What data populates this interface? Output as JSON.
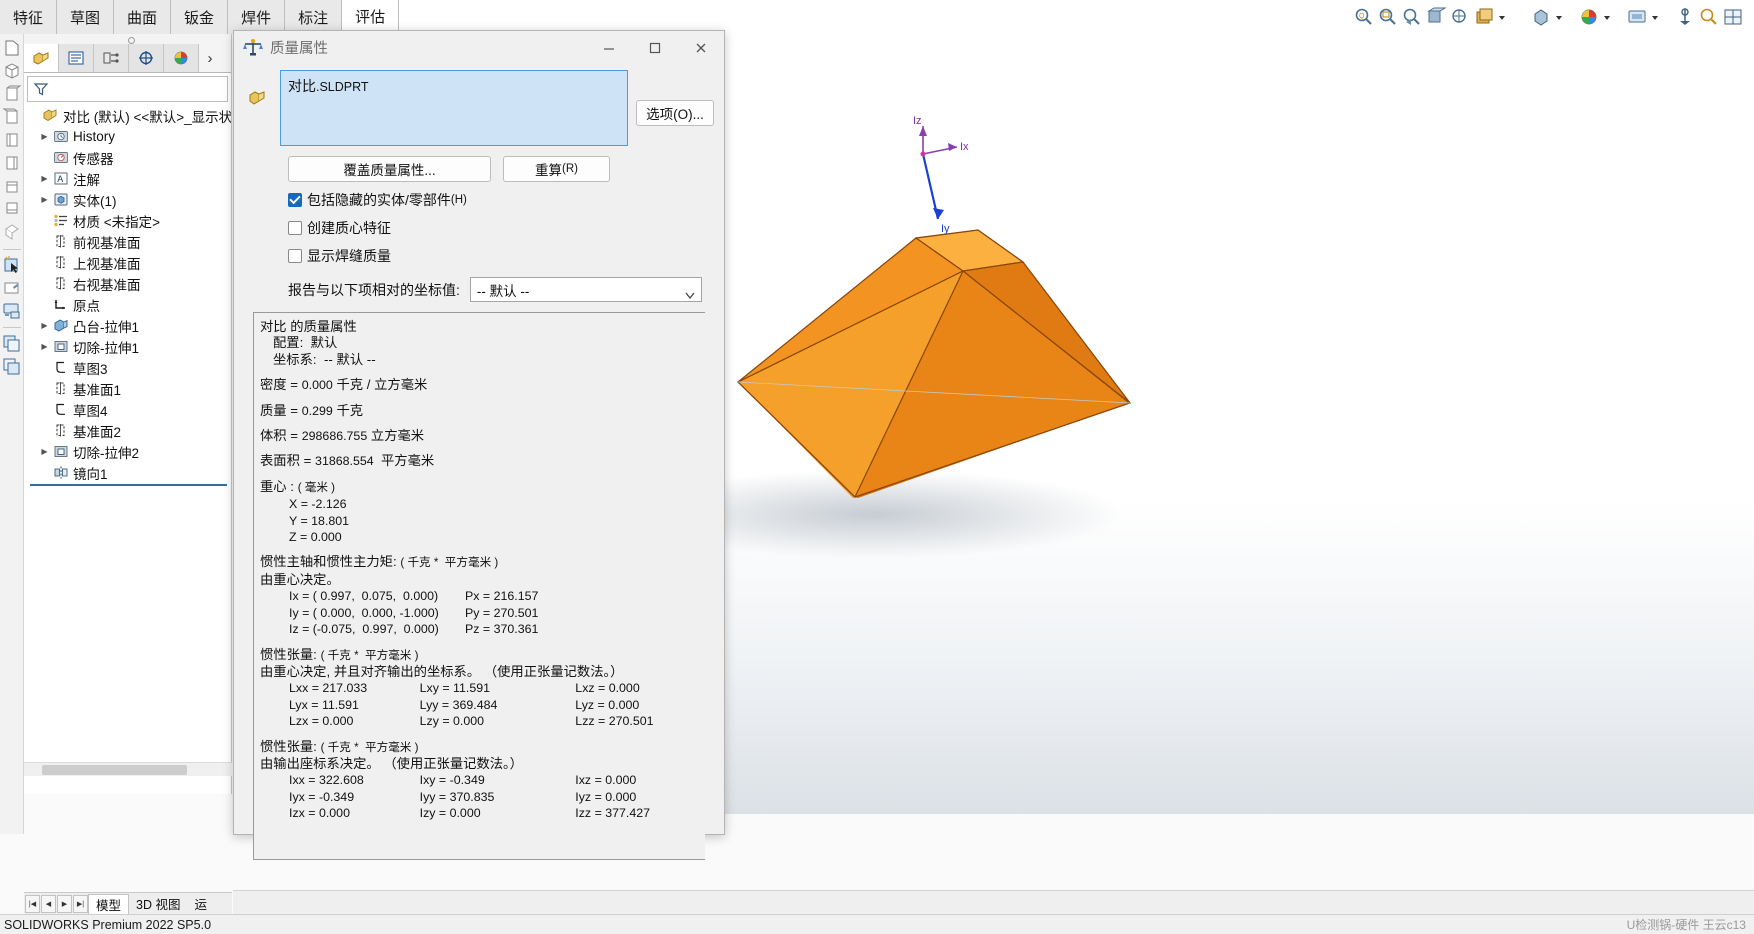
{
  "command_tabs": [
    {
      "label": "特征",
      "active": false
    },
    {
      "label": "草图",
      "active": false
    },
    {
      "label": "曲面",
      "active": false
    },
    {
      "label": "钣金",
      "active": false
    },
    {
      "label": "焊件",
      "active": false
    },
    {
      "label": "标注",
      "active": false
    },
    {
      "label": "评估",
      "active": true
    }
  ],
  "feature_manager": {
    "tabs": [
      {
        "name": "feature-tree-tab",
        "active": true
      },
      {
        "name": "property-manager-tab",
        "active": false
      },
      {
        "name": "configuration-manager-tab",
        "active": false
      },
      {
        "name": "dimxpert-manager-tab",
        "active": false
      },
      {
        "name": "display-manager-tab",
        "active": false
      }
    ],
    "more_tabs_glyph": "›",
    "filter_placeholder": "",
    "root": {
      "label": "对比 (默认) <<默认>_显示状态",
      "icon": "part-icon"
    },
    "items": [
      {
        "label": "History",
        "icon": "history-icon",
        "expandable": true,
        "indent": 1
      },
      {
        "label": "传感器",
        "icon": "sensor-icon",
        "expandable": false,
        "indent": 1
      },
      {
        "label": "注解",
        "icon": "annotation-icon",
        "expandable": true,
        "indent": 1
      },
      {
        "label": "实体(1)",
        "icon": "solid-bodies-icon",
        "expandable": true,
        "indent": 1
      },
      {
        "label": "材质 <未指定>",
        "icon": "material-icon",
        "expandable": false,
        "indent": 1
      },
      {
        "label": "前视基准面",
        "icon": "plane-icon",
        "expandable": false,
        "indent": 1
      },
      {
        "label": "上视基准面",
        "icon": "plane-icon",
        "expandable": false,
        "indent": 1
      },
      {
        "label": "右视基准面",
        "icon": "plane-icon",
        "expandable": false,
        "indent": 1
      },
      {
        "label": "原点",
        "icon": "origin-icon",
        "expandable": false,
        "indent": 1
      },
      {
        "label": "凸台-拉伸1",
        "icon": "boss-extrude-icon",
        "expandable": true,
        "indent": 1
      },
      {
        "label": "切除-拉伸1",
        "icon": "cut-extrude-icon",
        "expandable": true,
        "indent": 1
      },
      {
        "label": "草图3",
        "icon": "sketch-icon",
        "expandable": false,
        "indent": 1
      },
      {
        "label": "基准面1",
        "icon": "plane-icon",
        "expandable": false,
        "indent": 1
      },
      {
        "label": "草图4",
        "icon": "sketch-icon",
        "expandable": false,
        "indent": 1
      },
      {
        "label": "基准面2",
        "icon": "plane-icon",
        "expandable": false,
        "indent": 1
      },
      {
        "label": "切除-拉伸2",
        "icon": "cut-extrude-icon",
        "expandable": true,
        "indent": 1
      },
      {
        "label": "镜向1",
        "icon": "mirror-icon",
        "expandable": false,
        "indent": 1
      }
    ]
  },
  "doc_tabs": {
    "nav": [
      "|◀",
      "◀",
      "▶",
      "▶|"
    ],
    "tabs": [
      {
        "label": "模型",
        "active": true
      },
      {
        "label": "3D 视图",
        "active": false
      },
      {
        "label": "运",
        "active": false
      }
    ]
  },
  "status_bar": {
    "left": "SOLIDWORKS Premium 2022 SP5.0",
    "right": "U检测锅-硬件 王云c13"
  },
  "dialog": {
    "title": "质量属性",
    "title_icon": "scale-icon",
    "window_buttons": {
      "minimize": "—",
      "maximize": "▢",
      "close": "✕"
    },
    "selection": {
      "icon": "part-icon",
      "name": "对比",
      "extension": ".SLDPRT"
    },
    "options_button": "选项(O)...",
    "options_button_mnemonic": "(O)...",
    "override_button": "覆盖质量属性...",
    "recalc_button": "重算",
    "recalc_button_mnemonic": "(R)",
    "checkboxes": [
      {
        "label": "包括隐藏的实体/零部件",
        "mnemonic": "(H)",
        "checked": true,
        "name": "include-hidden-bodies-checkbox"
      },
      {
        "label": "创建质心特征",
        "mnemonic": "",
        "checked": false,
        "name": "create-cog-feature-checkbox"
      },
      {
        "label": "显示焊缝质量",
        "mnemonic": "",
        "checked": false,
        "name": "show-weld-bead-mass-checkbox"
      }
    ],
    "coord_label": "报告与以下项相对的坐标值:",
    "coord_value": "-- 默认 --",
    "report": {
      "header": "对比 的质量属性",
      "config_label": "配置:",
      "config_value": "默认",
      "coordsys_label": "坐标系:",
      "coordsys_value": "-- 默认 --",
      "density_label": "密度 =",
      "density_value": "0.000",
      "density_unit": "千克 / 立方毫米",
      "mass_label": "质量 =",
      "mass_value": "0.299",
      "mass_unit": "千克",
      "volume_label": "体积 =",
      "volume_value": "298686.755",
      "volume_unit": "立方毫米",
      "surface_label": "表面积 =",
      "surface_value": "31868.554",
      "surface_unit": "平方毫米",
      "cog_label": "重心 :",
      "cog_unit": "( 毫米 )",
      "cog_x": "X = -2.126",
      "cog_y": "Y = 18.801",
      "cog_z": "Z = 0.000",
      "principal_title": "惯性主轴和惯性主力矩:",
      "principal_unit": "( 千克 *  平方毫米 )",
      "principal_note": "由重心决定。",
      "principal_rows": [
        {
          "axis": "Ix = ( 0.997,  0.075,  0.000)",
          "p": "Px = 216.157"
        },
        {
          "axis": "Iy = ( 0.000,  0.000, -1.000)",
          "p": "Py = 270.501"
        },
        {
          "axis": "Iz = (-0.075,  0.997,  0.000)",
          "p": "Pz = 370.361"
        }
      ],
      "tensor1_title": "惯性张量:",
      "tensor1_unit": "( 千克 *  平方毫米 )",
      "tensor1_note": "由重心决定, 并且对齐输出的坐标系。 （使用正张量记数法。）",
      "tensor1_rows": [
        [
          "Lxx = 217.033",
          "Lxy = 11.591",
          "Lxz = 0.000"
        ],
        [
          "Lyx = 11.591",
          "Lyy = 369.484",
          "Lyz = 0.000"
        ],
        [
          "Lzx = 0.000",
          "Lzy = 0.000",
          "Lzz = 270.501"
        ]
      ],
      "tensor2_title": "惯性张量:",
      "tensor2_unit": "( 千克 *  平方毫米 )",
      "tensor2_note": "由输出座标系决定。 （使用正张量记数法。）",
      "tensor2_rows": [
        [
          "Ixx = 322.608",
          "Ixy = -0.349",
          "Ixz = 0.000"
        ],
        [
          "Iyx = -0.349",
          "Iyy = 370.835",
          "Iyz = 0.000"
        ],
        [
          "Izx = 0.000",
          "Izy = 0.000",
          "Izz = 377.427"
        ]
      ]
    }
  },
  "model": {
    "triad_labels": {
      "x": "Ix",
      "y": "Iy",
      "z": "Iz"
    },
    "colors": {
      "face_light": "#F08A1E",
      "face_mid": "#E07A12",
      "face_dark": "#C9650B",
      "edge": "#8a4708"
    }
  },
  "colors": {
    "accent": "#1669c1",
    "selection_bg": "#cfe3f7",
    "selection_border": "#4a9ee0",
    "panel_bg": "#f0f0f0"
  }
}
